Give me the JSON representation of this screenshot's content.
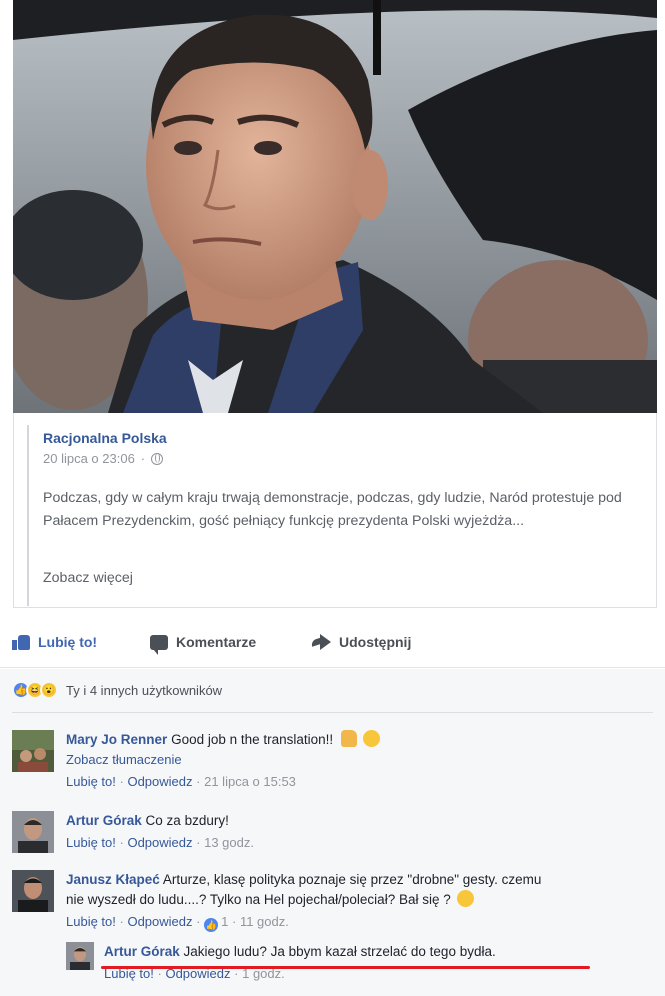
{
  "post": {
    "page_name": "Racjonalna Polska",
    "timestamp": "20 lipca o 23:06",
    "text": "Podczas, gdy w całym kraju trwają demonstracje, podczas, gdy ludzie, Naród protestuje pod Pałacem Prezydenckim, gość pełniący funkcję prezydenta Polski wyjeżdża...",
    "see_more": "Zobacz więcej"
  },
  "actions": {
    "like": "Lubię to!",
    "comment": "Komentarze",
    "share": "Udostępnij"
  },
  "reactions": {
    "summary": "Ty i 4 innych użytkowników",
    "icons": [
      "like-icon",
      "haha-icon",
      "wow-icon"
    ]
  },
  "comments": [
    {
      "author": "Mary Jo Renner",
      "text": "Good job n the translation!!",
      "translate": "Zobacz tłumaczenie",
      "like": "Lubię to!",
      "reply": "Odpowiedz",
      "time": "21 lipca o 15:53"
    },
    {
      "author": "Artur Górak",
      "text": "Co za bzdury!",
      "like": "Lubię to!",
      "reply": "Odpowiedz",
      "time": "13 godz."
    },
    {
      "author": "Janusz Kłapeć",
      "text_line1": "Arturze, klasę polityka poznaje się przez \"drobne\" gesty. czemu",
      "text_line2": "nie wyszedł do ludu....? Tylko na Hel pojechał/poleciał? Bał się ?",
      "like": "Lubię to!",
      "reply": "Odpowiedz",
      "like_count": "1",
      "time": "11 godz."
    },
    {
      "author": "Artur Górak",
      "text": "Jakiego ludu? Ja bbym kazał strzelać do tego bydła.",
      "like": "Lubię to!",
      "reply": "Odpowiedz",
      "time": "1 godz."
    }
  ],
  "colors": {
    "link_blue": "#365899",
    "action_blue": "#4267b2",
    "highlight_red": "#e21b23"
  }
}
